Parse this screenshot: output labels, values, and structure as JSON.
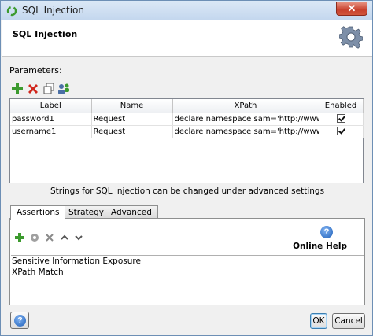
{
  "window": {
    "title": "SQL Injection",
    "close_label": "✕"
  },
  "header": {
    "heading": "SQL Injection"
  },
  "parameters": {
    "label": "Parameters:",
    "columns": [
      "Label",
      "Name",
      "XPath",
      "Enabled"
    ],
    "rows": [
      {
        "label": "password1",
        "name": "Request",
        "xpath": "declare namespace sam='http://www....",
        "enabled": true
      },
      {
        "label": "username1",
        "name": "Request",
        "xpath": "declare namespace sam='http://www....",
        "enabled": true
      }
    ]
  },
  "info_text": "Strings for SQL injection can be changed under advanced settings",
  "tabs": [
    {
      "label": "Assertions",
      "active": true
    },
    {
      "label": "Strategy",
      "active": false
    },
    {
      "label": "Advanced",
      "active": false
    }
  ],
  "assertions": {
    "help_label": "Online Help",
    "items": [
      "Sensitive Information Exposure",
      "XPath Match"
    ]
  },
  "footer": {
    "ok_label": "OK",
    "cancel_label": "Cancel"
  },
  "colors": {
    "add": "#3c9a2e",
    "remove": "#d0261c",
    "help": "#1f5fb8"
  }
}
